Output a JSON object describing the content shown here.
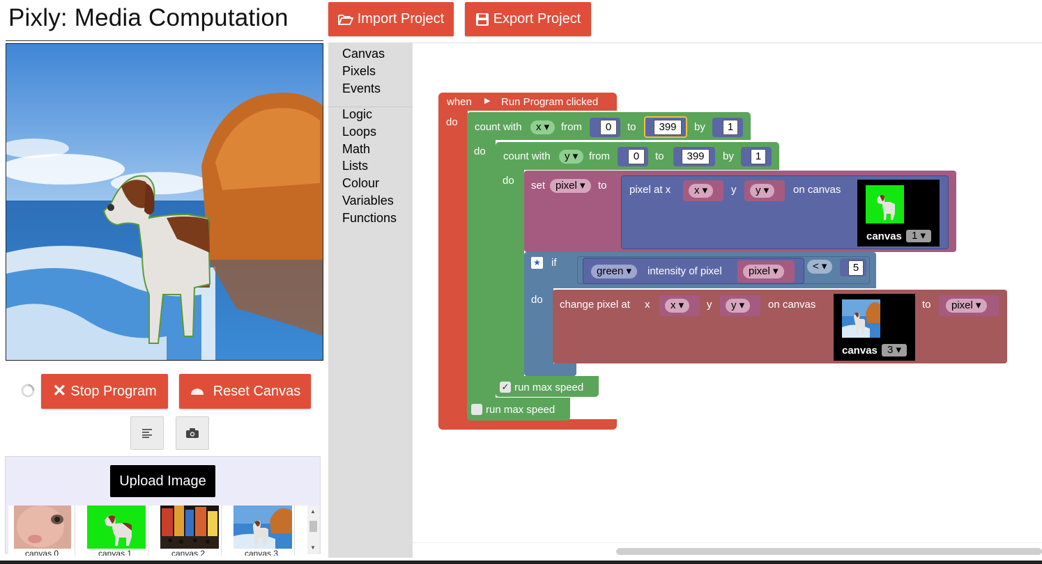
{
  "app": {
    "title": "Pixly: Media Computation"
  },
  "controls": {
    "stop_label": "Stop Program",
    "reset_label": "Reset Canvas",
    "upload_label": "Upload Image"
  },
  "gallery": [
    {
      "label": "canvas 0"
    },
    {
      "label": "canvas 1"
    },
    {
      "label": "canvas 2"
    },
    {
      "label": "canvas 3"
    }
  ],
  "topbar": {
    "import_label": "Import Project",
    "export_label": "Export Project"
  },
  "toolbox": {
    "group1": [
      "Canvas",
      "Pixels",
      "Events"
    ],
    "group2": [
      "Logic",
      "Loops",
      "Math",
      "Lists",
      "Colour",
      "Variables",
      "Functions"
    ]
  },
  "blocks": {
    "event": {
      "when": "when",
      "label": "Run Program clicked",
      "do": "do"
    },
    "loop_x": {
      "count_with": "count with",
      "var": "x",
      "from": "from",
      "from_val": "0",
      "to": "to",
      "to_val": "399",
      "by": "by",
      "by_val": "1",
      "do": "do",
      "run_max": "run max speed"
    },
    "loop_y": {
      "count_with": "count with",
      "var": "y",
      "from": "from",
      "from_val": "0",
      "to": "to",
      "to_val": "399",
      "by": "by",
      "by_val": "1",
      "do": "do",
      "run_max": "run max speed"
    },
    "set": {
      "set": "set",
      "var": "pixel",
      "to": "to",
      "pixel_at_x": "pixel at x",
      "x": "x",
      "y_label": "y",
      "y": "y",
      "on_canvas": "on canvas",
      "canvas_label": "canvas",
      "canvas_num": "1"
    },
    "if": {
      "if": "if",
      "do": "do",
      "channel": "green",
      "intensity": "intensity of pixel",
      "pixel": "pixel",
      "op": "<",
      "value": "5"
    },
    "change": {
      "label": "change pixel at",
      "x_label": "x",
      "x": "x",
      "y_label": "y",
      "y": "y",
      "on_canvas": "on canvas",
      "canvas_label": "canvas",
      "canvas_num": "3",
      "to": "to",
      "pixel": "pixel"
    }
  },
  "colors": {
    "accent": "#e04e39",
    "event_block": "#d9503c",
    "loop_block": "#5ba55b",
    "variable_block": "#a55b80",
    "pixel_block": "#5b67a5",
    "logic_block": "#5b80a5",
    "change_block": "#a5595b"
  }
}
